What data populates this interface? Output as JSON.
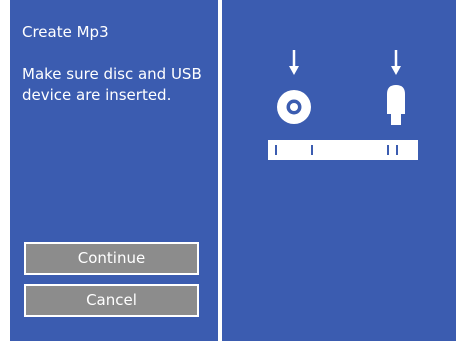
{
  "dialog": {
    "title": "Create Mp3",
    "message": "Make sure disc and USB device are inserted.",
    "continue_label": "Continue",
    "cancel_label": "Cancel"
  },
  "illustration": {
    "icons": [
      "disc-icon",
      "usb-drive-icon",
      "arrow-down-icon",
      "player-slot-icon"
    ]
  },
  "colors": {
    "panel_background": "#3b5cb0",
    "button_background": "#8c8c8c",
    "text": "#ffffff"
  }
}
